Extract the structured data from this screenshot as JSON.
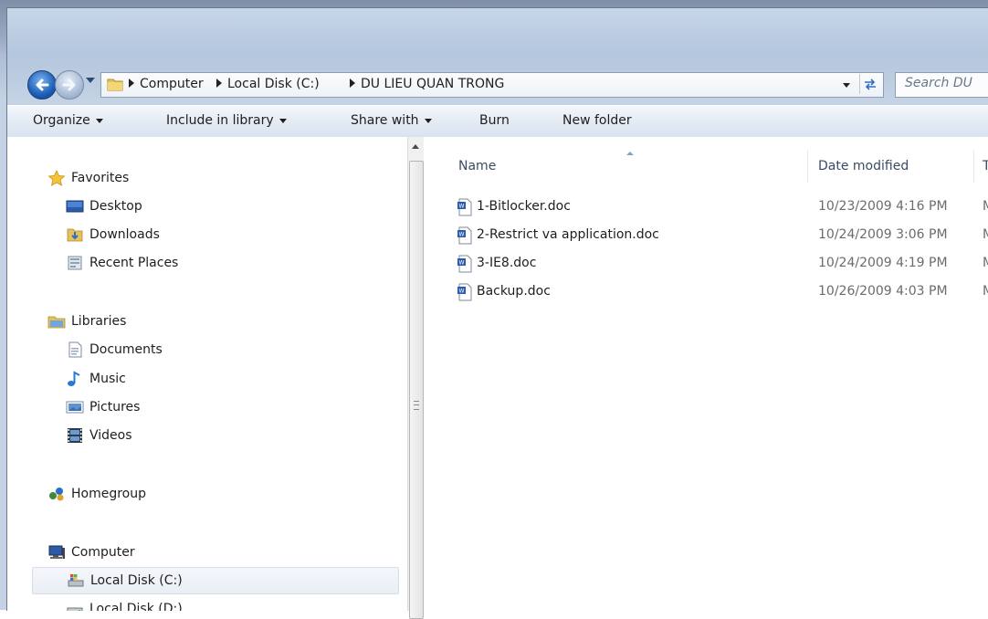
{
  "breadcrumb": [
    "Computer",
    "Local Disk (C:)",
    "DU LIEU QUAN TRONG"
  ],
  "search": {
    "placeholder": "Search DU"
  },
  "toolbar": {
    "organize": "Organize",
    "include_in_library": "Include in library",
    "share_with": "Share with",
    "burn": "Burn",
    "new_folder": "New folder"
  },
  "nav": {
    "favorites": "Favorites",
    "desktop": "Desktop",
    "downloads": "Downloads",
    "recent_places": "Recent Places",
    "libraries": "Libraries",
    "documents": "Documents",
    "music": "Music",
    "pictures": "Pictures",
    "videos": "Videos",
    "homegroup": "Homegroup",
    "computer": "Computer",
    "local_disk_c": "Local Disk (C:)",
    "local_disk_d": "Local Disk (D:)"
  },
  "columns": {
    "name": "Name",
    "date_modified": "Date modified",
    "type": "Ty"
  },
  "files": [
    {
      "name": "1-Bitlocker.doc",
      "date": "10/23/2009 4:16 PM",
      "type": "M"
    },
    {
      "name": "2-Restrict va application.doc",
      "date": "10/24/2009 3:06 PM",
      "type": "M"
    },
    {
      "name": "3-IE8.doc",
      "date": "10/24/2009 4:19 PM",
      "type": "M"
    },
    {
      "name": "Backup.doc",
      "date": "10/26/2009 4:03 PM",
      "type": "M"
    }
  ],
  "icons": {
    "back": "back-arrow-icon",
    "forward": "forward-arrow-icon",
    "folder": "folder-icon",
    "refresh": "refresh-icon",
    "word_document": "word-document-icon"
  },
  "colors": {
    "accent": "#1c5fb8",
    "toolbar_bg": "#e4ebf4",
    "column_header": "#3b4b66"
  }
}
